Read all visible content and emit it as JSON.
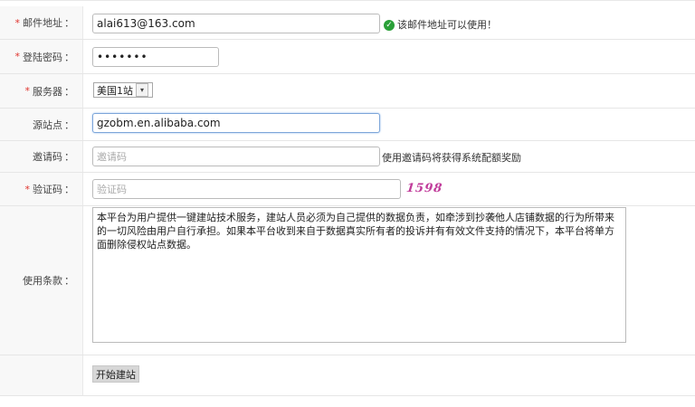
{
  "form": {
    "email": {
      "label": "邮件地址",
      "value": "alai613@163.com",
      "hint": "该邮件地址可以使用！"
    },
    "password": {
      "label": "登陆密码",
      "value": "•••••••"
    },
    "server": {
      "label": "服务器",
      "selected": "美国1站"
    },
    "source": {
      "label": "源站点",
      "value": "gzobm.en.alibaba.com"
    },
    "invite": {
      "label": "邀请码",
      "placeholder": "邀请码",
      "hint": "使用邀请码将获得系统配额奖励"
    },
    "captcha": {
      "label": "验证码",
      "placeholder": "验证码",
      "code": "1598"
    },
    "terms": {
      "label": "使用条款",
      "text": "本平台为用户提供一键建站技术服务，建站人员必须为自己提供的数据负责，如牵涉到抄袭他人店铺数据的行为所带来的一切风险由用户自行承担。如果本平台收到来自于数据真实所有者的投诉并有有效文件支持的情况下，本平台将单方面删除侵权站点数据。"
    },
    "required_mark": "*",
    "colon": "：",
    "submit_label": "开始建站"
  },
  "colors": {
    "required": "#e0332d",
    "ok": "#2aa038",
    "captcha": "#c03b9a",
    "focus_border": "#7da6d9"
  }
}
